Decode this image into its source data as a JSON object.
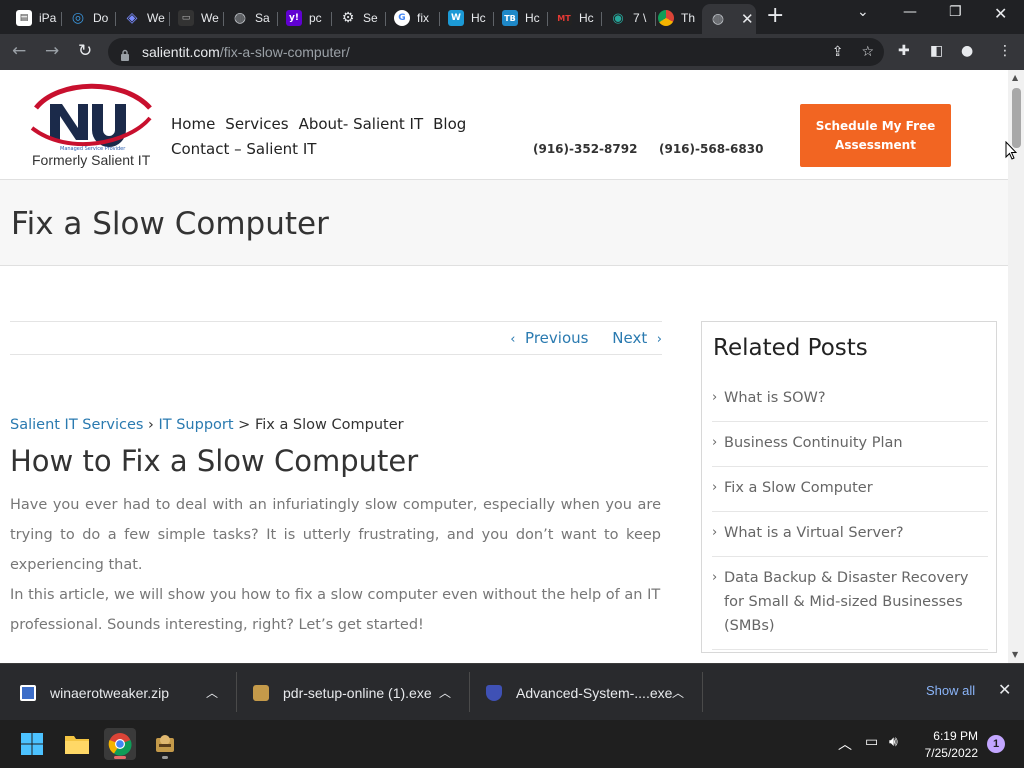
{
  "browser": {
    "tabs": [
      {
        "label": "iPa",
        "icon": "ipa-favicon-icon",
        "color": "#ffffff"
      },
      {
        "label": "Do",
        "icon": "edge-favicon-icon",
        "color": "#3a96dd"
      },
      {
        "label": "We",
        "icon": "windows-favicon-icon",
        "color": "#7a8cff"
      },
      {
        "label": "We",
        "icon": "monitor-favicon-icon",
        "color": "#333333"
      },
      {
        "label": "Sa",
        "icon": "globe-favicon-icon",
        "color": "#9aa0a6"
      },
      {
        "label": "pc",
        "icon": "yahoo-favicon-icon",
        "color": "#6001d2"
      },
      {
        "label": "Se",
        "icon": "gear-favicon-icon",
        "color": "#e8eaed"
      },
      {
        "label": "fix",
        "icon": "google-favicon-icon",
        "color": "#ffffff"
      },
      {
        "label": "Hc",
        "icon": "w-favicon-icon",
        "color": "#1c9ad6"
      },
      {
        "label": "Hc",
        "icon": "tb-favicon-icon",
        "color": "#1e88c8"
      },
      {
        "label": "Hc",
        "icon": "mt-favicon-icon",
        "color": "#c62828"
      },
      {
        "label": "7 \\",
        "icon": "eye-favicon-icon",
        "color": "#26a69a"
      },
      {
        "label": "Th",
        "icon": "chrome-favicon-icon",
        "color": "#e8eaed"
      }
    ],
    "url_domain": "salientit.com",
    "url_path": "/fix-a-slow-computer/"
  },
  "site": {
    "logo_caption": "Formerly Salient IT",
    "logo_tagline": "Managed Service Provider",
    "nav": [
      "Home",
      "Services",
      "About- Salient IT",
      "Blog",
      "Contact – Salient IT"
    ],
    "phone1": "(916)-352-8792",
    "phone2": "(916)-568-6830",
    "cta": "Schedule My Free Assessment"
  },
  "page": {
    "title": "Fix a Slow Computer",
    "pager_prev": "Previous",
    "pager_next": "Next",
    "breadcrumb": {
      "crumb1": "Salient IT Services",
      "sep1": " › ",
      "crumb2": "IT Support",
      "sep2": " > ",
      "current": "Fix a Slow Computer"
    },
    "article_title": "How to Fix a Slow Computer",
    "paragraph1": "Have you ever had to deal with an infuriatingly slow computer, especially when you are trying to do a few simple tasks? It is utterly frustrating, and you don’t want to keep experiencing that.",
    "paragraph2": "In this article, we will show you how to fix a slow computer even without the help of an IT professional. Sounds interesting, right? Let’s get started!"
  },
  "sidebar": {
    "title": "Related Posts",
    "items": [
      "What is SOW?",
      "Business Continuity Plan",
      "Fix a Slow Computer",
      "What is a Virtual Server?",
      "Data Backup & Disaster Recovery for Small & Mid-sized Businesses (SMBs)"
    ]
  },
  "downloads": {
    "items": [
      {
        "name": "winaerotweaker.zip",
        "icon": "zip-file-icon"
      },
      {
        "name": "pdr-setup-online (1).exe",
        "icon": "installer-file-icon"
      },
      {
        "name": "Advanced-System-....exe",
        "icon": "shield-file-icon"
      }
    ],
    "show_all": "Show all"
  },
  "taskbar": {
    "time": "6:19 PM",
    "date": "7/25/2022",
    "notifications": "1"
  },
  "colors": {
    "accent_orange": "#f26522",
    "link_blue": "#2a7ab0",
    "logo_red": "#c8102e",
    "logo_navy": "#1b2a4a"
  }
}
